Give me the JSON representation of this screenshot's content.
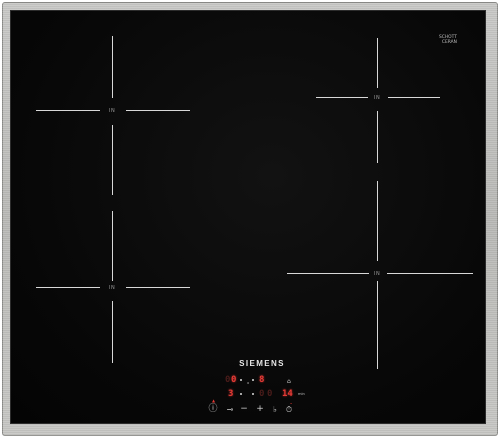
{
  "brand": "SIEMENS",
  "glass_maker": [
    "SCHOTT",
    "CERAN"
  ],
  "glass_maker_sub": "",
  "top_code": "",
  "zone_label": "IN",
  "control_panel": {
    "top_left_digits": "0",
    "top_right_digits": "8",
    "bottom_left_digits": "3",
    "bottom_right_digits": "14",
    "power_symbol": "ⓘ",
    "lock_symbol": "⊸",
    "minus_symbol": "−",
    "plus_symbol": "+",
    "boost_symbol": "♭",
    "timer_symbol": "⏱",
    "min_label": "min"
  },
  "colors": {
    "glass": "#070707",
    "frame": "#bdbdba",
    "marks": "#d8d8d8",
    "display_red": "#e53a35"
  }
}
